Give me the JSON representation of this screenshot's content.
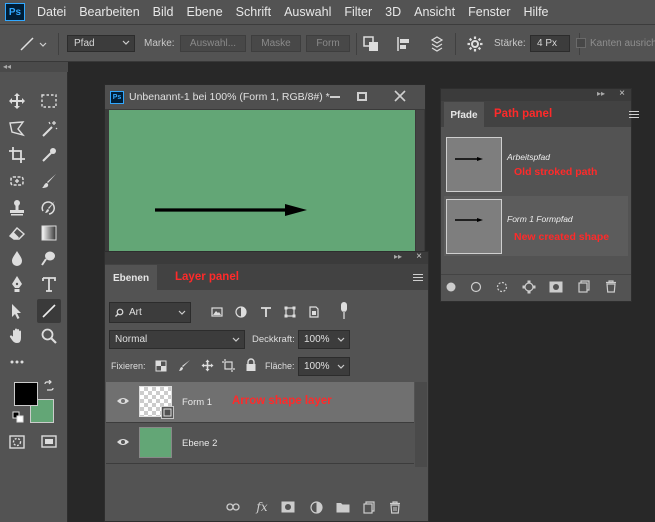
{
  "app_logo": "Ps",
  "menu": [
    "Datei",
    "Bearbeiten",
    "Bild",
    "Ebene",
    "Schrift",
    "Auswahl",
    "Filter",
    "3D",
    "Ansicht",
    "Fenster",
    "Hilfe"
  ],
  "options": {
    "mode_value": "Pfad",
    "marke_label": "Marke:",
    "auswahl_btn": "Auswahl...",
    "maske_btn": "Maske",
    "form_btn": "Form",
    "staerke_label": "Stärke:",
    "staerke_value": "4 Px",
    "kanten_label": "Kanten ausrichte"
  },
  "document": {
    "title": "Unbenannt-1 bei 100% (Form 1, RGB/8#) *",
    "canvas_color": "#63a676"
  },
  "layers_panel": {
    "tab": "Ebenen",
    "note": "Layer panel",
    "filter_value": "Art",
    "blend_mode": "Normal",
    "opacity_label": "Deckkraft:",
    "opacity_value": "100%",
    "lock_label": "Fixieren:",
    "fill_label": "Fläche:",
    "fill_value": "100%",
    "layers": [
      {
        "name": "Form 1",
        "note": "Arrow shape layer",
        "selected": true
      },
      {
        "name": "Ebene 2",
        "selected": false
      }
    ],
    "footer_fx": "fx"
  },
  "paths_panel": {
    "tab": "Pfade",
    "note": "Path panel",
    "paths": [
      {
        "name": "Arbeitspfad",
        "note": "Old stroked path"
      },
      {
        "name": "Form 1 Formpfad",
        "note": "New created shape"
      }
    ]
  },
  "colors": {
    "foreground": "#000000",
    "background": "#63a676",
    "annotation": "#ff2a2a"
  }
}
